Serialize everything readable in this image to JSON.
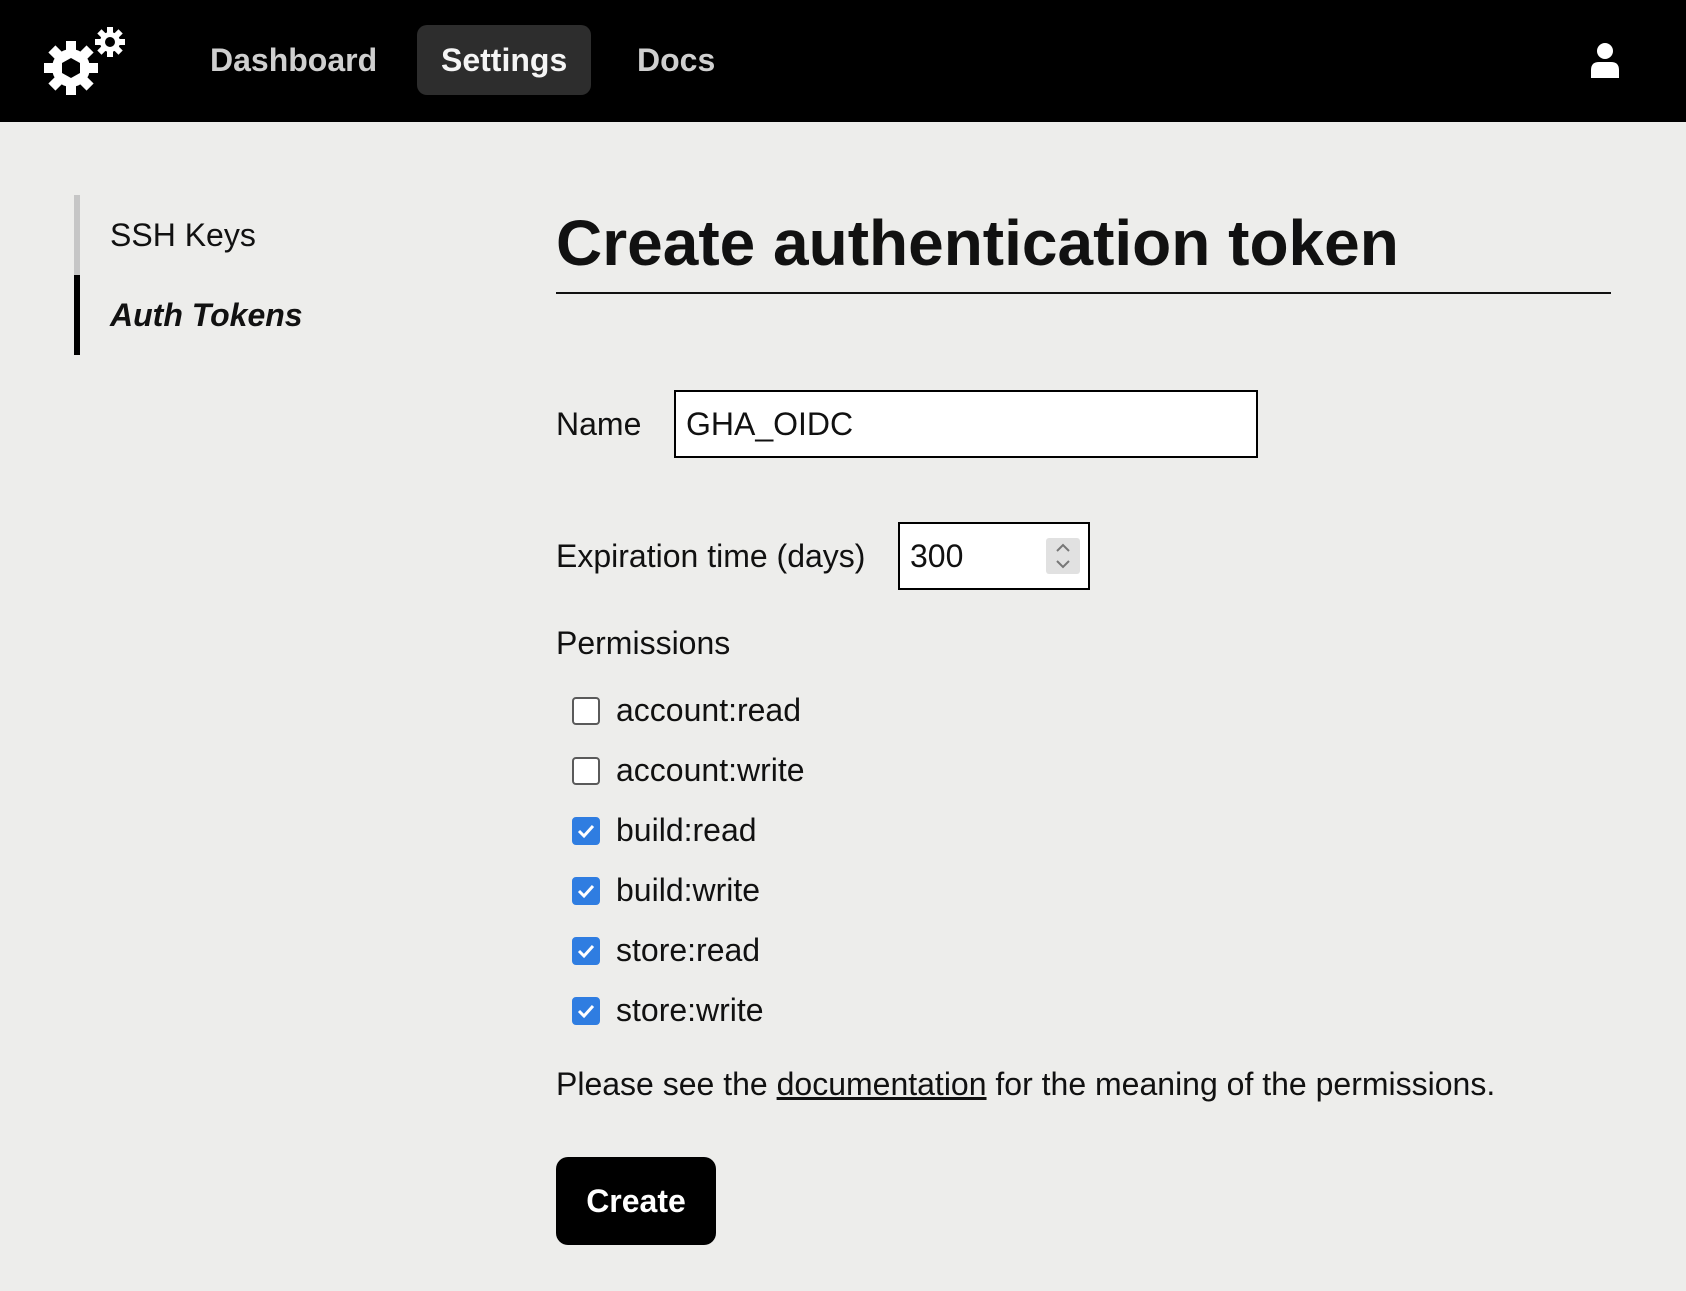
{
  "nav": {
    "logo_icon": "gears-icon",
    "items": [
      {
        "label": "Dashboard",
        "active": false
      },
      {
        "label": "Settings",
        "active": true
      },
      {
        "label": "Docs",
        "active": false
      }
    ],
    "user_icon": "user-icon"
  },
  "sidebar": {
    "items": [
      {
        "label": "SSH Keys",
        "active": false
      },
      {
        "label": "Auth Tokens",
        "active": true
      }
    ]
  },
  "main": {
    "title": "Create authentication token",
    "name_label": "Name",
    "name_value": "GHA_OIDC",
    "expiration_label": "Expiration time (days)",
    "expiration_value": "300",
    "permissions_label": "Permissions",
    "permissions": [
      {
        "label": "account:read",
        "checked": false
      },
      {
        "label": "account:write",
        "checked": false
      },
      {
        "label": "build:read",
        "checked": true
      },
      {
        "label": "build:write",
        "checked": true
      },
      {
        "label": "store:read",
        "checked": true
      },
      {
        "label": "store:write",
        "checked": true
      }
    ],
    "note_prefix": "Please see the ",
    "note_link": "documentation",
    "note_suffix": " for the meaning of the permissions.",
    "create_label": "Create"
  },
  "colors": {
    "topbar": "#000000",
    "background": "#ededeb",
    "checkbox_checked": "#2f7de1"
  }
}
